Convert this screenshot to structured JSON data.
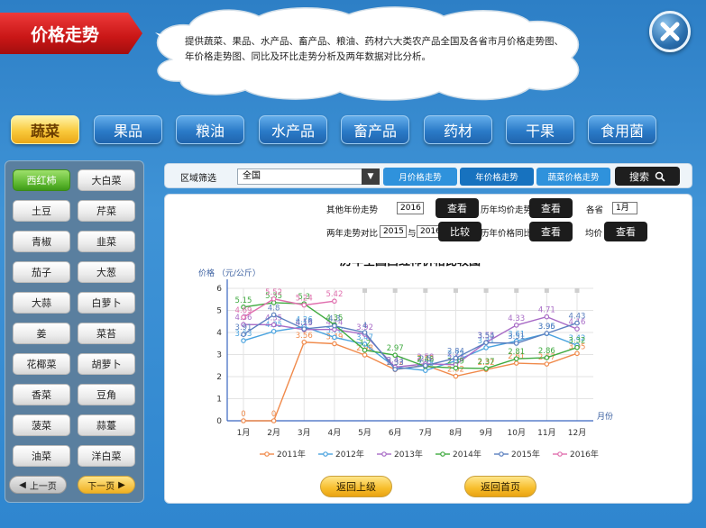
{
  "header": {
    "title": "价格走势",
    "intro": "提供蔬菜、果品、水产品、畜产品、粮油、药材六大类农产品全国及各省市月价格走势图、年价格走势图、同比及环比走势分析及两年数据对比分析。"
  },
  "categories": [
    {
      "label": "蔬菜",
      "active": true
    },
    {
      "label": "果品",
      "active": false
    },
    {
      "label": "粮油",
      "active": false
    },
    {
      "label": "水产品",
      "active": false
    },
    {
      "label": "畜产品",
      "active": false
    },
    {
      "label": "药材",
      "active": false
    },
    {
      "label": "干果",
      "active": false
    },
    {
      "label": "食用菌",
      "active": false
    }
  ],
  "vegetables": [
    "西红柿",
    "大白菜",
    "土豆",
    "芹菜",
    "青椒",
    "韭菜",
    "茄子",
    "大葱",
    "大蒜",
    "白萝卜",
    "姜",
    "菜苔",
    "花椰菜",
    "胡萝卜",
    "香菜",
    "豆角",
    "菠菜",
    "蒜薹",
    "油菜",
    "洋白菜"
  ],
  "pager": {
    "prev": "上一页",
    "next": "下一页"
  },
  "filter": {
    "region_label": "区域筛选",
    "region_value": "全国",
    "tabs": [
      "月价格走势",
      "年价格走势",
      "蔬菜价格走势"
    ],
    "search": "搜索"
  },
  "controls": {
    "other_year_label": "其他年份走势",
    "other_year_value": "2016",
    "view": "查看",
    "hist_avg_label": "历年均价走势",
    "province_label": "各省",
    "month_value": "1月",
    "two_year_label": "两年走势对比",
    "year_a": "2015",
    "with": "与",
    "year_b": "2016",
    "compare": "比较",
    "yoy_label": "历年价格同比",
    "avg_label": "均价"
  },
  "buttons": {
    "back_prev": "返回上级",
    "back_home": "返回首页"
  },
  "colors": {
    "accent": "#f9c93c",
    "brand": "#2d7fc6"
  },
  "chart_data": {
    "type": "line",
    "title": "历年全国西红柿价格比较图",
    "ylabel": "价格 （元/公斤）",
    "xlabel": "月份",
    "ylim": [
      0,
      6
    ],
    "categories": [
      "1月",
      "2月",
      "3月",
      "4月",
      "5月",
      "6月",
      "7月",
      "8月",
      "9月",
      "10月",
      "11月",
      "12月"
    ],
    "series": [
      {
        "name": "2011年",
        "color": "#f08a4b",
        "values": [
          0,
          0,
          3.56,
          3.49,
          2.98,
          2.32,
          2.52,
          2.02,
          2.32,
          2.61,
          2.57,
          3.05
        ]
      },
      {
        "name": "2012年",
        "color": "#4aa3df",
        "values": [
          3.63,
          4.05,
          4.26,
          3.78,
          3.47,
          2.43,
          2.28,
          2.72,
          3.31,
          3.61,
          3.95,
          3.42
        ]
      },
      {
        "name": "2013年",
        "color": "#a86bc6",
        "values": [
          4.36,
          4.35,
          4.13,
          4.14,
          3.92,
          2.43,
          2.58,
          2.54,
          3.55,
          4.33,
          4.71,
          4.16
        ]
      },
      {
        "name": "2014年",
        "color": "#3faa3f",
        "values": [
          5.15,
          5.35,
          5.3,
          4.35,
          3.2,
          2.97,
          2.46,
          2.39,
          2.37,
          2.81,
          2.86,
          3.32
        ]
      },
      {
        "name": "2015年",
        "color": "#5a7fbf",
        "values": [
          3.91,
          4.8,
          4.16,
          4.3,
          4.0,
          2.33,
          2.5,
          2.84,
          3.54,
          3.51,
          3.96,
          4.43
        ]
      },
      {
        "name": "2016年",
        "color": "#e06fae",
        "values": [
          4.69,
          5.52,
          5.24,
          5.42,
          null,
          null,
          null,
          null,
          null,
          null,
          null,
          null
        ]
      }
    ]
  }
}
